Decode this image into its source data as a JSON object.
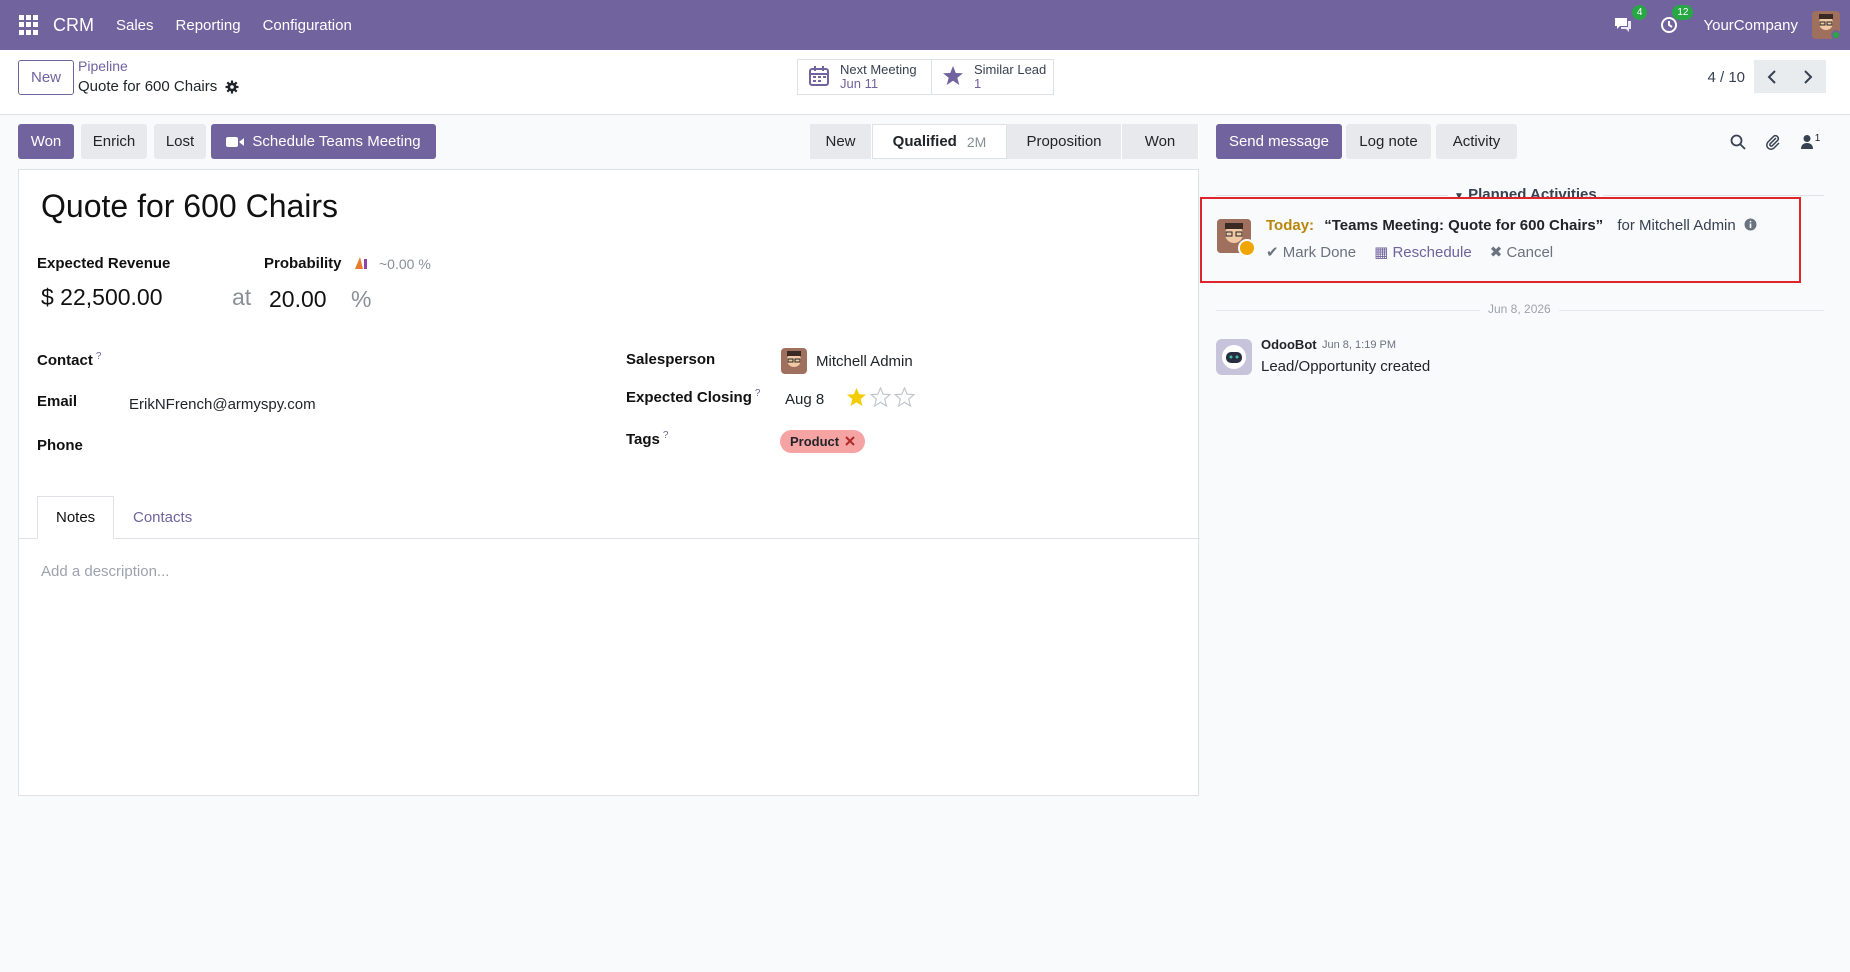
{
  "navbar": {
    "brand": "CRM",
    "menu": [
      "Sales",
      "Reporting",
      "Configuration"
    ],
    "messages_count": "4",
    "activities_count": "12",
    "company": "YourCompany"
  },
  "control": {
    "new_label": "New",
    "breadcrumb_parent": "Pipeline",
    "breadcrumb_current": "Quote for 600 Chairs",
    "smart_buttons": [
      {
        "label": "Next Meeting",
        "value": "Jun 11",
        "icon": "calendar-icon"
      },
      {
        "label": "Similar Lead",
        "value": "1",
        "icon": "star-icon"
      }
    ],
    "pager": "4 / 10"
  },
  "actions": {
    "won": "Won",
    "enrich": "Enrich",
    "lost": "Lost",
    "schedule": "Schedule Teams Meeting"
  },
  "stages": [
    {
      "label": "New",
      "duration": ""
    },
    {
      "label": "Qualified",
      "duration": "2M",
      "active": true
    },
    {
      "label": "Proposition",
      "duration": ""
    },
    {
      "label": "Won",
      "duration": ""
    }
  ],
  "form": {
    "title": "Quote for 600 Chairs",
    "expected_revenue_label": "Expected Revenue",
    "expected_revenue": "$ 22,500.00",
    "at": "at",
    "probability_label": "Probability",
    "probability_ai": "~0.00 %",
    "probability": "20.00",
    "percent": "%",
    "contact_label": "Contact",
    "email_label": "Email",
    "email": "ErikNFrench@armyspy.com",
    "phone_label": "Phone",
    "salesperson_label": "Salesperson",
    "salesperson": "Mitchell Admin",
    "expected_closing_label": "Expected Closing",
    "expected_closing": "Aug 8",
    "priority_stars": 1,
    "tags_label": "Tags",
    "tags": [
      "Product"
    ],
    "help_mark": "?",
    "tabs": [
      "Notes",
      "Contacts"
    ],
    "description_placeholder": "Add a description..."
  },
  "chatter": {
    "send_message": "Send message",
    "log_note": "Log note",
    "activity": "Activity",
    "followers_count": "1",
    "planned_header": "Planned Activities",
    "activity_item": {
      "when": "Today:",
      "title": "“Teams Meeting: Quote for 600 Chairs”",
      "for": "for Mitchell Admin",
      "mark_done": "Mark Done",
      "reschedule": "Reschedule",
      "cancel": "Cancel"
    },
    "date_separator": "Jun 8, 2026",
    "message": {
      "author": "OdooBot",
      "time": "Jun 8, 1:19 PM",
      "body": "Lead/Opportunity created"
    }
  },
  "colors": {
    "brand": "#71639e",
    "tag": "#f5a3a3",
    "highlight": "#e0242b",
    "star": "#f3cc00"
  }
}
